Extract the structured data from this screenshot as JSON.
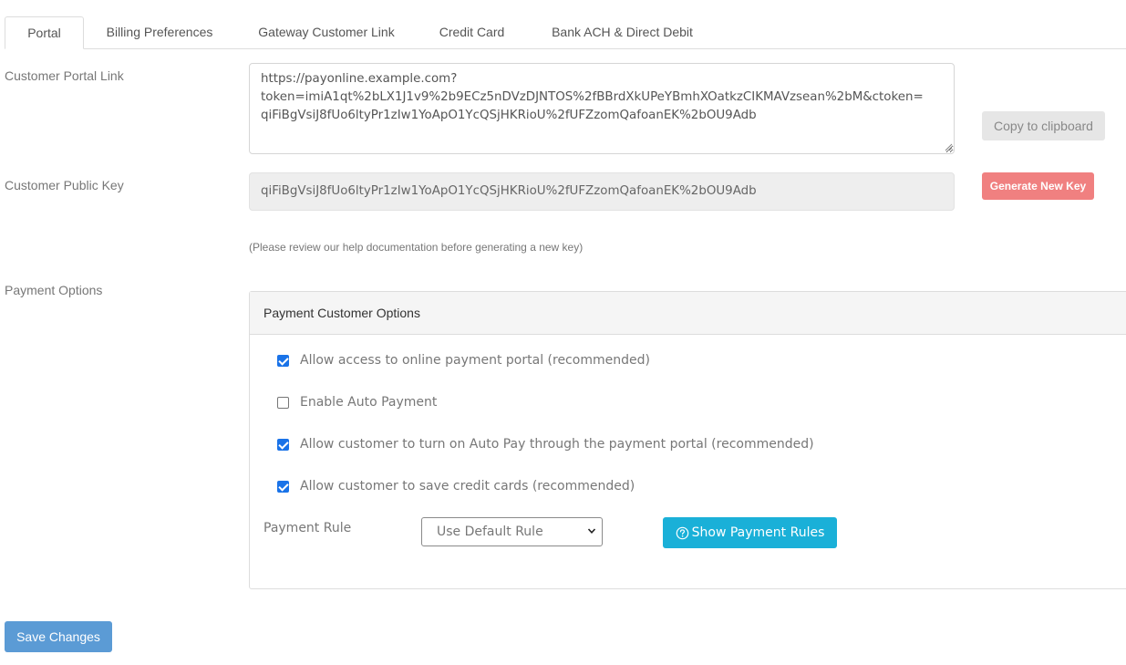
{
  "tabs": [
    {
      "label": "Portal",
      "active": true
    },
    {
      "label": "Billing Preferences",
      "active": false
    },
    {
      "label": "Gateway Customer Link",
      "active": false
    },
    {
      "label": "Credit Card",
      "active": false
    },
    {
      "label": "Bank ACH & Direct Debit",
      "active": false
    }
  ],
  "portal_link": {
    "label": "Customer Portal Link",
    "value": "https://payonline.example.com?\ntoken=imiA1qt%2bLX1J1v9%2b9ECz5nDVzDJNTOS%2fBBrdXkUPeYBmhXOatkzCIKMAVzsean%2bM&ctoken=\nqiFiBgVsiJ8fUo6ltyPr1zIw1YoApO1YcQSjHKRioU%2fUFZzomQafoanEK%2bOU9Adb",
    "copy_label": "Copy to clipboard"
  },
  "public_key": {
    "label": "Customer Public Key",
    "value": "qiFiBgVsiJ8fUo6ltyPr1zIw1YoApO1YcQSjHKRioU%2fUFZzomQafoanEK%2bOU9Adb",
    "generate_label": "Generate New Key",
    "help_note": "(Please review our help documentation before generating a new key)"
  },
  "payment_options": {
    "label": "Payment Options",
    "panel_title": "Payment Customer Options",
    "checkboxes": [
      {
        "label": "Allow access to online payment portal (recommended)",
        "checked": true
      },
      {
        "label": "Enable Auto Payment",
        "checked": false
      },
      {
        "label": "Allow customer to turn on Auto Pay through the payment portal (recommended)",
        "checked": true
      },
      {
        "label": "Allow customer to save credit cards (recommended)",
        "checked": true
      }
    ],
    "rule_label": "Payment Rule",
    "rule_selected": "Use Default Rule",
    "show_rules_label": "Show Payment Rules"
  },
  "save_label": "Save Changes",
  "icons": {
    "show_rules": "question-circle-icon",
    "select": "chevron-down-icon"
  },
  "colors": {
    "generate_button": "#f08080",
    "show_rules_button": "#1ab0d8",
    "save_button": "#5b9bd5",
    "checkbox_checked": "#1a73e8"
  }
}
